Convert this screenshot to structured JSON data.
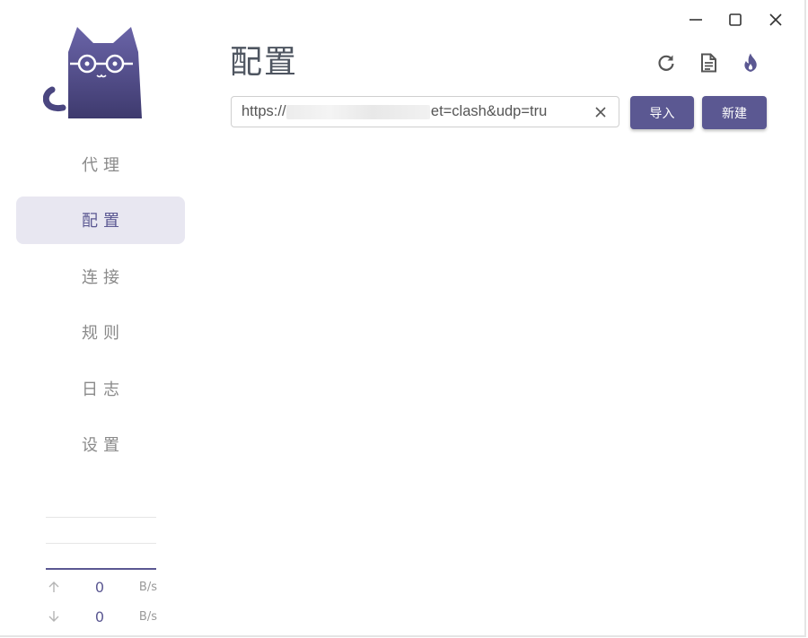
{
  "sidebar": {
    "items": [
      {
        "label": "代理",
        "active": false
      },
      {
        "label": "配置",
        "active": true
      },
      {
        "label": "连接",
        "active": false
      },
      {
        "label": "规则",
        "active": false
      },
      {
        "label": "日志",
        "active": false
      },
      {
        "label": "设置",
        "active": false
      }
    ],
    "traffic": {
      "upload": {
        "value": "0",
        "unit": "B/s",
        "icon": "arrow-up-icon"
      },
      "download": {
        "value": "0",
        "unit": "B/s",
        "icon": "arrow-down-icon"
      }
    }
  },
  "window_controls": [
    "minimize-icon",
    "maximize-icon",
    "close-icon"
  ],
  "main": {
    "title": "配置",
    "header_icons": [
      "refresh-icon",
      "log-file-icon",
      "fire-icon"
    ],
    "url_input": {
      "value": "https://                              arget=clash&udp=tru",
      "placeholder": ""
    },
    "import_label": "导入",
    "new_label": "新建"
  },
  "colors": {
    "accent": "#5b5892",
    "active_bg": "#e8e7f1",
    "nav_text": "#8a8a8a",
    "title_text": "#4e5560"
  }
}
